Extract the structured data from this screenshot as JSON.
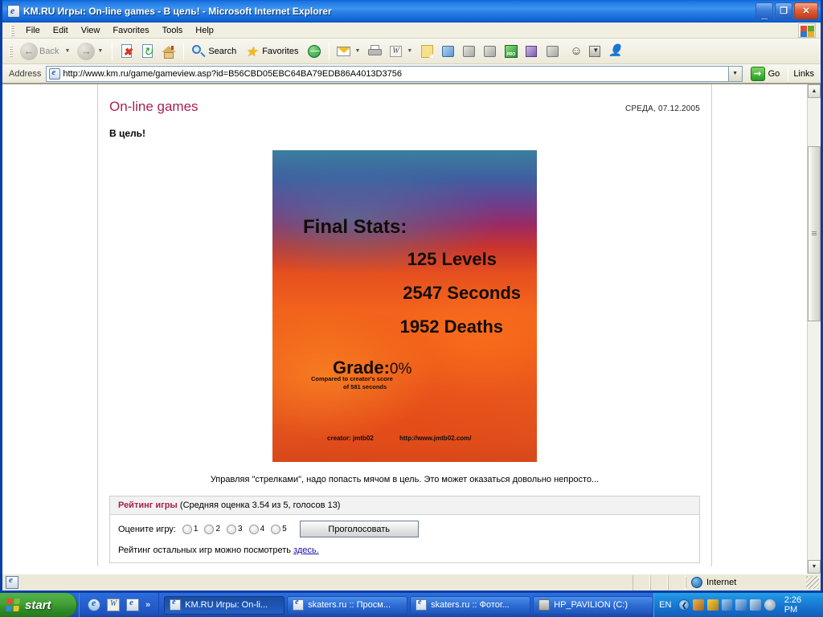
{
  "window": {
    "title": "KM.RU Игры: On-line games - В цель! - Microsoft Internet Explorer",
    "minimize": "_",
    "restore": "❐",
    "close": "✕"
  },
  "menu": {
    "items": [
      "File",
      "Edit",
      "View",
      "Favorites",
      "Tools",
      "Help"
    ]
  },
  "toolbar": {
    "back": "Back",
    "forward": "",
    "stop_icon": "stop-icon",
    "refresh_icon": "refresh-icon",
    "home_icon": "home-icon",
    "search": "Search",
    "favorites": "Favorites",
    "history_icon": "history-icon",
    "mail_icon": "mail-icon",
    "print_icon": "print-icon",
    "edit_word_icon": "edit-word-icon",
    "dropdown_arrow": "▼",
    "extra_icons": [
      "note-icon",
      "messenger-icon",
      "research-icon",
      "dictionary-icon",
      "pro-icon",
      "encyclopedia-icon",
      "copy-icon",
      "person-icon",
      "download-icon",
      "people-icon"
    ]
  },
  "address": {
    "label": "Address",
    "url": "http://www.km.ru/game/gameview.asp?id=B56CBD05EBC64BA79EDB86A4013D3756",
    "go": "Go",
    "links": "Links",
    "dropdown": "▼"
  },
  "page": {
    "title": "On-line games",
    "date": "СРЕДА, 07.12.2005",
    "game_title": "В цель!",
    "description": "Управляя \"стрелками\", надо попасть мячом в цель. Это может оказаться довольно непросто...",
    "game_image": {
      "heading": "Final Stats:",
      "levels": "125 Levels",
      "seconds": "2547  Seconds",
      "deaths": "1952 Deaths",
      "grade_label": "Grade:",
      "grade_value": "0%",
      "note_line1": "Compared to creator's score",
      "note_line2": "of 581 seconds",
      "creator": "creator: jmtb02",
      "creator_url": "http://www.jmtb02.com/"
    },
    "rating": {
      "heading_bold": "Рейтинг игры",
      "heading_rest": "(Средняя оценка 3.54 из 5, голосов 13)",
      "rate_label": "Оцените игру:",
      "options": [
        "1",
        "2",
        "3",
        "4",
        "5"
      ],
      "vote_button": "Проголосовать",
      "footer_text": "Рейтинг остальных игр можно посмотреть ",
      "footer_link": "здесь."
    }
  },
  "statusbar": {
    "message": "",
    "zone": "Internet"
  },
  "taskbar": {
    "start": "start",
    "quicklaunch_chevron": "»",
    "tasks": [
      {
        "label": "KM.RU Игры: On-li...",
        "active": true
      },
      {
        "label": "skaters.ru :: Просм...",
        "active": false
      },
      {
        "label": "skaters.ru :: Фотог...",
        "active": false
      },
      {
        "label": "HP_PAVILION (C:)",
        "active": false
      }
    ],
    "language": "EN",
    "clock": "2:26 PM",
    "tray_chevron": "❮"
  },
  "colors": {
    "accent": "#a82050",
    "titlebar": "#1d76e2",
    "taskbar": "#245fc4",
    "link": "#1a0dab"
  },
  "scroll": {
    "up": "▲",
    "down": "▼"
  }
}
